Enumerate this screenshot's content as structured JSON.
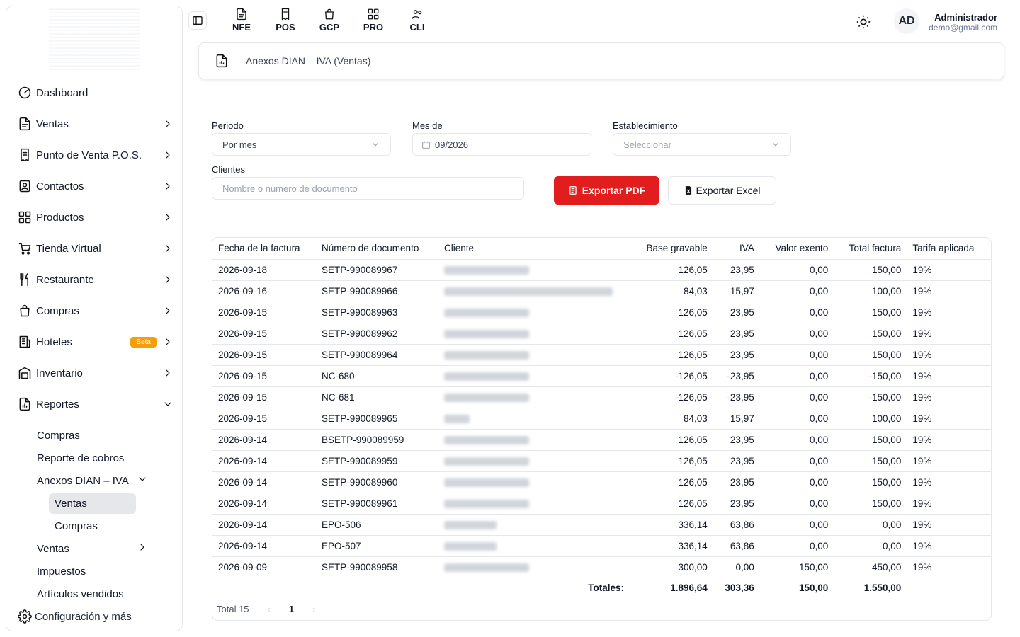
{
  "sidebar": {
    "items": [
      {
        "label": "Dashboard",
        "icon": "dashboard-icon",
        "chevron": false
      },
      {
        "label": "Ventas",
        "icon": "document-icon",
        "chevron": true
      },
      {
        "label": "Punto de Venta P.O.S.",
        "icon": "receipt-icon",
        "chevron": true
      },
      {
        "label": "Contactos",
        "icon": "contacts-icon",
        "chevron": true
      },
      {
        "label": "Productos",
        "icon": "grid-icon",
        "chevron": true
      },
      {
        "label": "Tienda Virtual",
        "icon": "cart-icon",
        "chevron": true
      },
      {
        "label": "Restaurante",
        "icon": "utensils-icon",
        "chevron": true
      },
      {
        "label": "Compras",
        "icon": "bag-icon",
        "chevron": true
      },
      {
        "label": "Hoteles",
        "icon": "hotel-icon",
        "chevron": true,
        "badge": "Beta"
      },
      {
        "label": "Inventario",
        "icon": "warehouse-icon",
        "chevron": true
      },
      {
        "label": "Reportes",
        "icon": "report-icon",
        "chevron": true,
        "expanded": true
      }
    ],
    "reportes_sub": [
      "Compras",
      "Reporte de cobros",
      "Anexos DIAN – IVA",
      "Ventas",
      "Compras",
      "Ventas",
      "Impuestos",
      "Artículos vendidos"
    ],
    "config_label": "Configuración y más"
  },
  "topbar": {
    "modules": [
      "NFE",
      "POS",
      "GCP",
      "PRO",
      "CLI"
    ],
    "avatar_initials": "AD",
    "user_name": "Administrador",
    "user_email": "demo@gmail.com"
  },
  "page": {
    "title": "Anexos DIAN – IVA (Ventas)"
  },
  "filters": {
    "periodo_label": "Periodo",
    "periodo_value": "Por mes",
    "mes_label": "Mes de",
    "mes_value": "09/2026",
    "establecimiento_label": "Establecimiento",
    "establecimiento_placeholder": "Seleccionar",
    "clientes_label": "Clientes",
    "clientes_placeholder": "Nombre o número de documento",
    "export_pdf": "Exportar PDF",
    "export_excel": "Exportar Excel"
  },
  "table": {
    "headers": [
      "Fecha de la factura",
      "Número de documento",
      "Cliente",
      "Base gravable",
      "IVA",
      "Valor exento",
      "Total factura",
      "Tarifa aplicada"
    ],
    "rows": [
      [
        "2026-09-18",
        "SETP-990089967",
        "120",
        "126,05",
        "23,95",
        "0,00",
        "150,00",
        "19%"
      ],
      [
        "2026-09-16",
        "SETP-990089966",
        "238",
        "84,03",
        "15,97",
        "0,00",
        "100,00",
        "19%"
      ],
      [
        "2026-09-15",
        "SETP-990089963",
        "120",
        "126,05",
        "23,95",
        "0,00",
        "150,00",
        "19%"
      ],
      [
        "2026-09-15",
        "SETP-990089962",
        "120",
        "126,05",
        "23,95",
        "0,00",
        "150,00",
        "19%"
      ],
      [
        "2026-09-15",
        "SETP-990089964",
        "120",
        "126,05",
        "23,95",
        "0,00",
        "150,00",
        "19%"
      ],
      [
        "2026-09-15",
        "NC-680",
        "120",
        "-126,05",
        "-23,95",
        "0,00",
        "-150,00",
        "19%"
      ],
      [
        "2026-09-15",
        "NC-681",
        "120",
        "-126,05",
        "-23,95",
        "0,00",
        "-150,00",
        "19%"
      ],
      [
        "2026-09-15",
        "SETP-990089965",
        "36",
        "84,03",
        "15,97",
        "0,00",
        "100,00",
        "19%"
      ],
      [
        "2026-09-14",
        "BSETP-990089959",
        "120",
        "126,05",
        "23,95",
        "0,00",
        "150,00",
        "19%"
      ],
      [
        "2026-09-14",
        "SETP-990089959",
        "120",
        "126,05",
        "23,95",
        "0,00",
        "150,00",
        "19%"
      ],
      [
        "2026-09-14",
        "SETP-990089960",
        "120",
        "126,05",
        "23,95",
        "0,00",
        "150,00",
        "19%"
      ],
      [
        "2026-09-14",
        "SETP-990089961",
        "120",
        "126,05",
        "23,95",
        "0,00",
        "150,00",
        "19%"
      ],
      [
        "2026-09-14",
        "EPO-506",
        "74",
        "336,14",
        "63,86",
        "0,00",
        "0,00",
        "19%"
      ],
      [
        "2026-09-14",
        "EPO-507",
        "74",
        "336,14",
        "63,86",
        "0,00",
        "0,00",
        "19%"
      ],
      [
        "2026-09-09",
        "SETP-990089958",
        "120",
        "300,00",
        "0,00",
        "150,00",
        "450,00",
        "19%"
      ]
    ],
    "totals_label": "Totales:",
    "totals": [
      "1.896,64",
      "303,36",
      "150,00",
      "1.550,00"
    ]
  },
  "pager": {
    "total": "Total 15",
    "page": "1"
  }
}
